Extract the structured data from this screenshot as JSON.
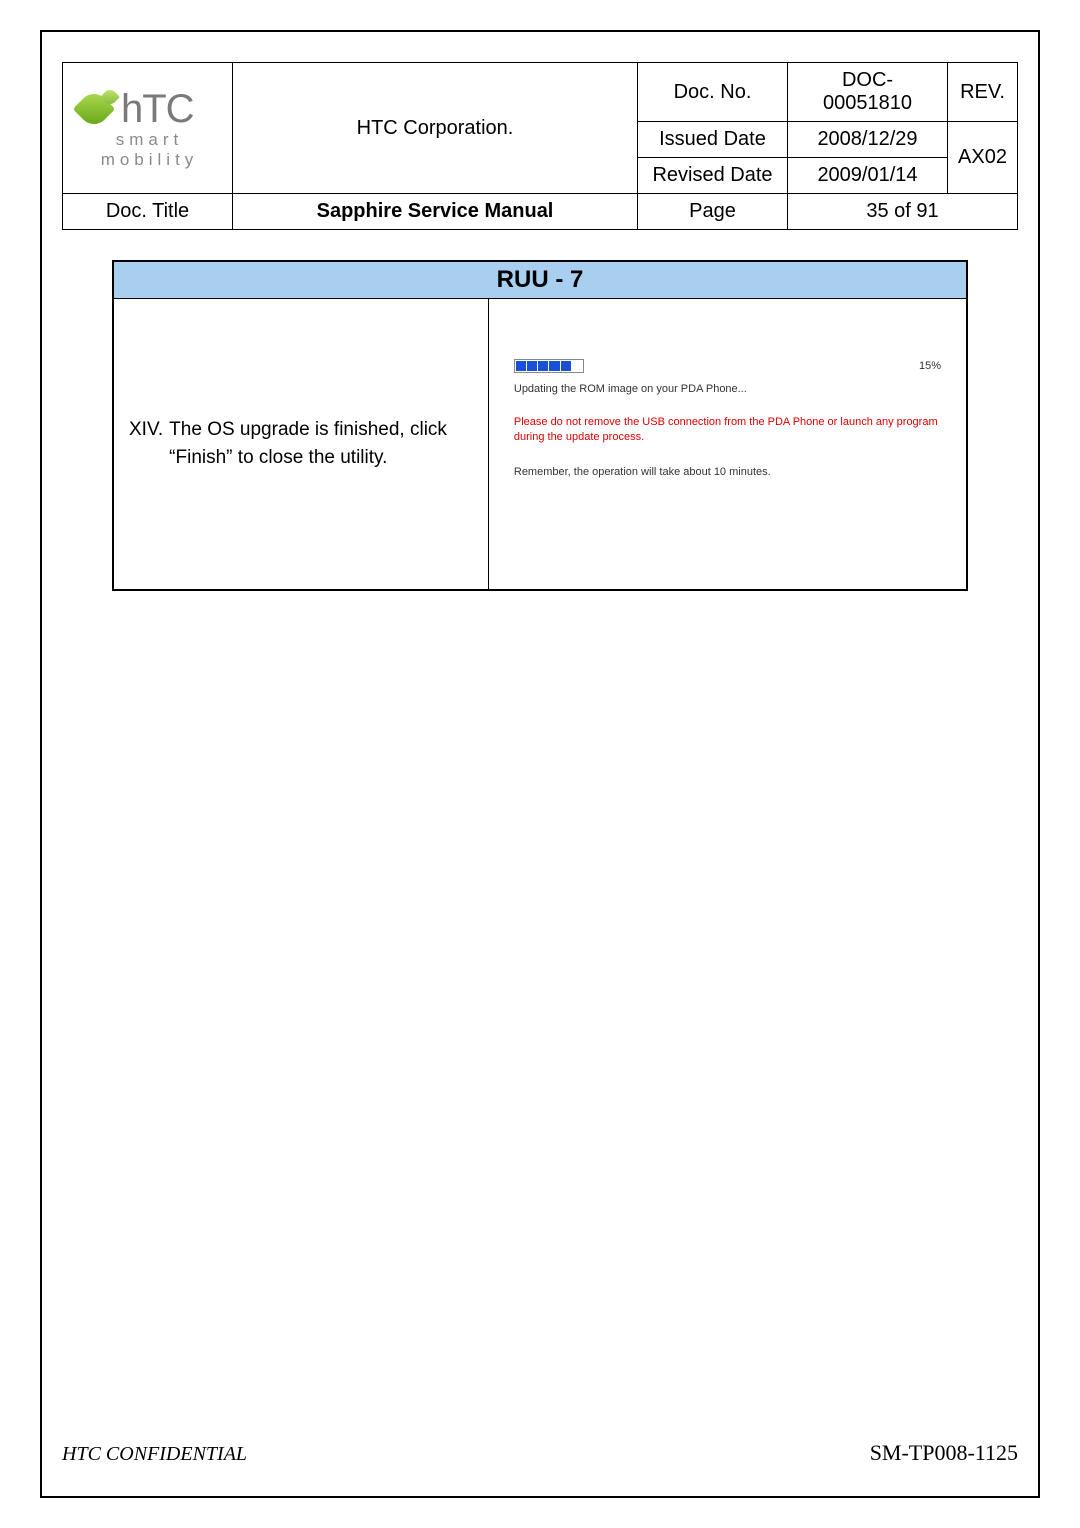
{
  "header": {
    "company": "HTC Corporation.",
    "logo_main": "hTC",
    "logo_sub": "smart mobility",
    "rows": {
      "doc_no_label": "Doc. No.",
      "doc_no_value": "DOC-00051810",
      "rev_label": "REV.",
      "rev_value": "AX02",
      "issued_label": "Issued Date",
      "issued_value": "2008/12/29",
      "revised_label": "Revised Date",
      "revised_value": "2009/01/14",
      "doc_title_label": "Doc. Title",
      "doc_title_value": "Sapphire Service Manual",
      "page_label": "Page",
      "page_value": "35 of 91"
    }
  },
  "ruu": {
    "title": "RUU - 7",
    "instruction_number": "XIV.",
    "instruction_text": "The OS upgrade is finished, click “Finish” to close the utility.",
    "progress_pct": "15%",
    "updating": "Updating the ROM image on your PDA Phone...",
    "warning": "Please do not remove the USB connection from the PDA Phone or launch any program during the update process.",
    "remember": "Remember, the operation will take about 10 minutes."
  },
  "footer": {
    "confidential": "HTC CONFIDENTIAL",
    "code": "SM-TP008-1125"
  }
}
